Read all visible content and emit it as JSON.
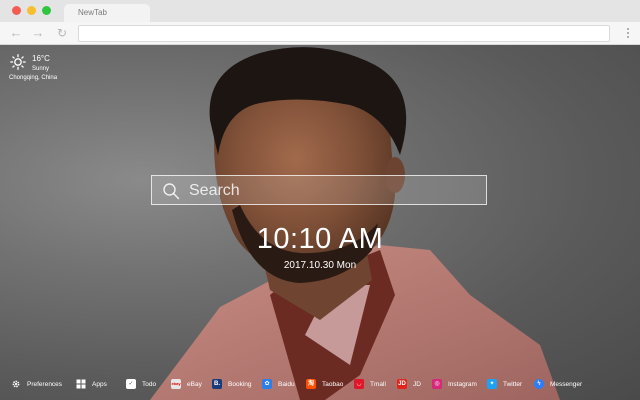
{
  "browser": {
    "tab_title": "NewTab",
    "address": ""
  },
  "weather": {
    "temperature": "16°C",
    "condition": "Sunny",
    "location": "Chongqing,  China",
    "icon": "sun-icon"
  },
  "search": {
    "placeholder": "Search"
  },
  "clock": {
    "time": "10:10 AM",
    "date": "2017.10.30 Mon"
  },
  "bottombar": {
    "items": [
      {
        "label": "Preferences",
        "icon": "gear-icon",
        "color": "transparent"
      },
      {
        "label": "Apps",
        "icon": "grid-icon",
        "color": "transparent"
      },
      {
        "label": "Todo",
        "icon": "checkbox-icon",
        "color": "#ffffff"
      },
      {
        "label": "eBay",
        "icon": "ebay-icon",
        "color": "#e6e6e6"
      },
      {
        "label": "Booking",
        "icon": "booking-icon",
        "color": "#1b3a7a"
      },
      {
        "label": "Baidu",
        "icon": "baidu-icon",
        "color": "#2d7fe8"
      },
      {
        "label": "Taobao",
        "icon": "taobao-icon",
        "color": "#ff5000"
      },
      {
        "label": "Tmall",
        "icon": "tmall-icon",
        "color": "#e0162b"
      },
      {
        "label": "JD",
        "icon": "jd-icon",
        "color": "#e1251b"
      },
      {
        "label": "Instagram",
        "icon": "instagram-icon",
        "color": "#d6297c"
      },
      {
        "label": "Twitter",
        "icon": "twitter-icon",
        "color": "#1da1f2"
      },
      {
        "label": "Messenger",
        "icon": "messenger-icon",
        "color": "#2b7dfc"
      }
    ]
  }
}
